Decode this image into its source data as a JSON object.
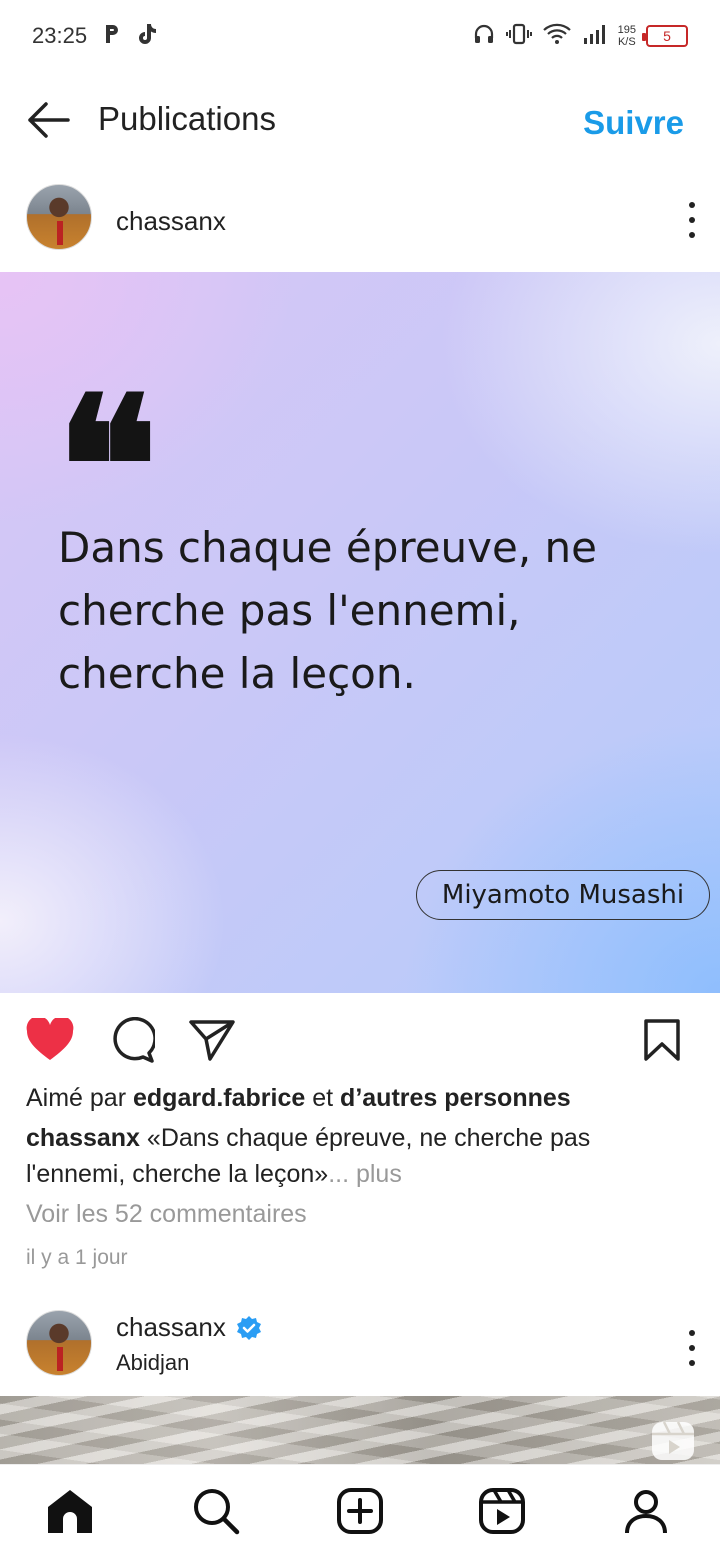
{
  "status_bar": {
    "time": "23:25",
    "left_icons": [
      "p-app-icon",
      "tiktok-icon"
    ],
    "right_icons": [
      "headset-icon",
      "vibrate-icon",
      "wifi-icon",
      "signal-icon"
    ],
    "speed_value": "195",
    "speed_unit": "K/S",
    "battery": "5"
  },
  "header": {
    "back_icon": "arrow-left-icon",
    "title": "Publications",
    "follow_label": "Suivre",
    "accent_color": "#1a9be8"
  },
  "post": {
    "username": "chassanx",
    "more_icon": "three-dots-vertical-icon",
    "image": {
      "quote_mark": "❝",
      "quote_text": "Dans chaque épreuve, ne cherche pas l'ennemi, cherche la leçon.",
      "author": "Miyamoto Musashi"
    },
    "actions": {
      "like_icon": "heart-filled-icon",
      "like_color": "#ed3046",
      "comment_icon": "comment-icon",
      "share_icon": "send-icon",
      "save_icon": "bookmark-icon"
    },
    "likes": {
      "prefix": "Aimé par",
      "user": "edgard.fabrice",
      "connector": "et",
      "others": "d’autres personnes"
    },
    "caption": {
      "username": "chassanx",
      "text": "«Dans chaque épreuve, ne cherche pas l'ennemi, cherche la leçon»",
      "more_label": "... plus"
    },
    "comments_link": "Voir les 52 commentaires",
    "timestamp": "il y a 1 jour"
  },
  "next_post": {
    "username": "chassanx",
    "verified_icon": "verified-badge-icon",
    "location": "Abidjan",
    "more_icon": "three-dots-vertical-icon",
    "media_icon": "reel-icon"
  },
  "bottom_nav": {
    "items": [
      "home-icon",
      "search-icon",
      "create-icon",
      "reels-icon",
      "profile-icon"
    ]
  }
}
